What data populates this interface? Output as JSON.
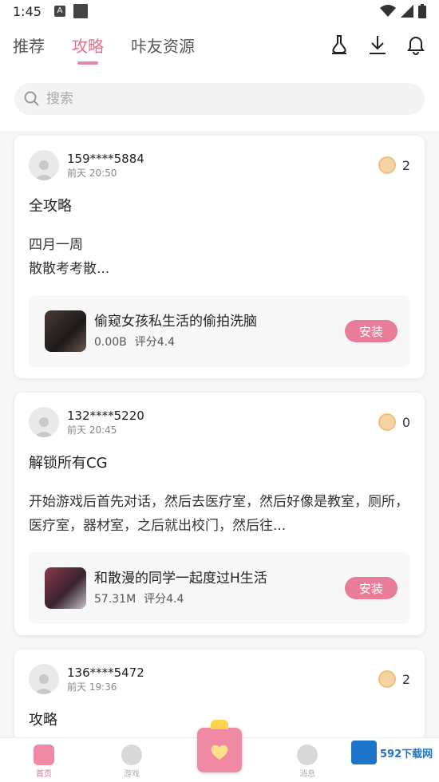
{
  "status": {
    "time": "1:45",
    "badge": "A"
  },
  "nav": {
    "tabs": [
      "推荐",
      "攻略",
      "咔友资源"
    ],
    "active_tab": 1
  },
  "search": {
    "placeholder": "搜索"
  },
  "posts": [
    {
      "user": "159****5884",
      "time": "前天 20:50",
      "coins": "2",
      "title": "全攻略",
      "body": "四月一周\n散散考考散...",
      "game": {
        "name": "偷窥女孩私生活的偷拍洗脑",
        "size": "0.00B",
        "score": "评分4.4"
      }
    },
    {
      "user": "132****5220",
      "time": "前天 20:45",
      "coins": "0",
      "title": "解锁所有CG",
      "body": "开始游戏后首先对话，然后去医疗室，然后好像是教室，厕所，医疗室，器材室，之后就出校门，然后往...",
      "game": {
        "name": "和散漫的同学一起度过H生活",
        "size": "57.31M",
        "score": "评分4.4"
      }
    },
    {
      "user": "136****5472",
      "time": "前天 19:36",
      "coins": "2",
      "title": "攻略",
      "body": "",
      "game": null
    }
  ],
  "install_label": "安装",
  "bottom_nav": {
    "items": [
      "首页",
      "游戏",
      "",
      "消息",
      ""
    ]
  },
  "watermark": "592下载网",
  "colors": {
    "accent": "#e0708c",
    "install": "#e97c98",
    "gift": "#f08aa4"
  }
}
